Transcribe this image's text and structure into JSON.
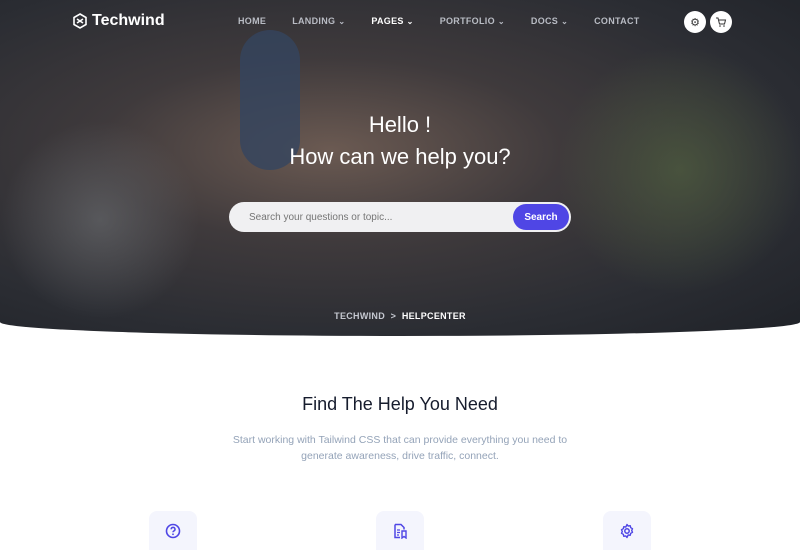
{
  "brand": "Techwind",
  "nav": {
    "items": [
      {
        "label": "HOME",
        "dd": false
      },
      {
        "label": "LANDING",
        "dd": true
      },
      {
        "label": "PAGES",
        "dd": true,
        "active": true
      },
      {
        "label": "PORTFOLIO",
        "dd": true
      },
      {
        "label": "DOCS",
        "dd": true
      },
      {
        "label": "CONTACT",
        "dd": false
      }
    ]
  },
  "hero": {
    "line1": "Hello !",
    "line2": "How can we help you?",
    "search_placeholder": "Search your questions or topic...",
    "search_button": "Search"
  },
  "breadcrumb": {
    "root": "TECHWIND",
    "sep": ">",
    "current": "HELPCENTER"
  },
  "section": {
    "title": "Find The Help You Need",
    "description": "Start working with Tailwind CSS that can provide everything you need to generate awareness, drive traffic, connect."
  },
  "cards": [
    {
      "icon": "question-circle-icon"
    },
    {
      "icon": "document-icon"
    },
    {
      "icon": "gear-icon"
    }
  ],
  "colors": {
    "accent": "#4f46e5"
  }
}
